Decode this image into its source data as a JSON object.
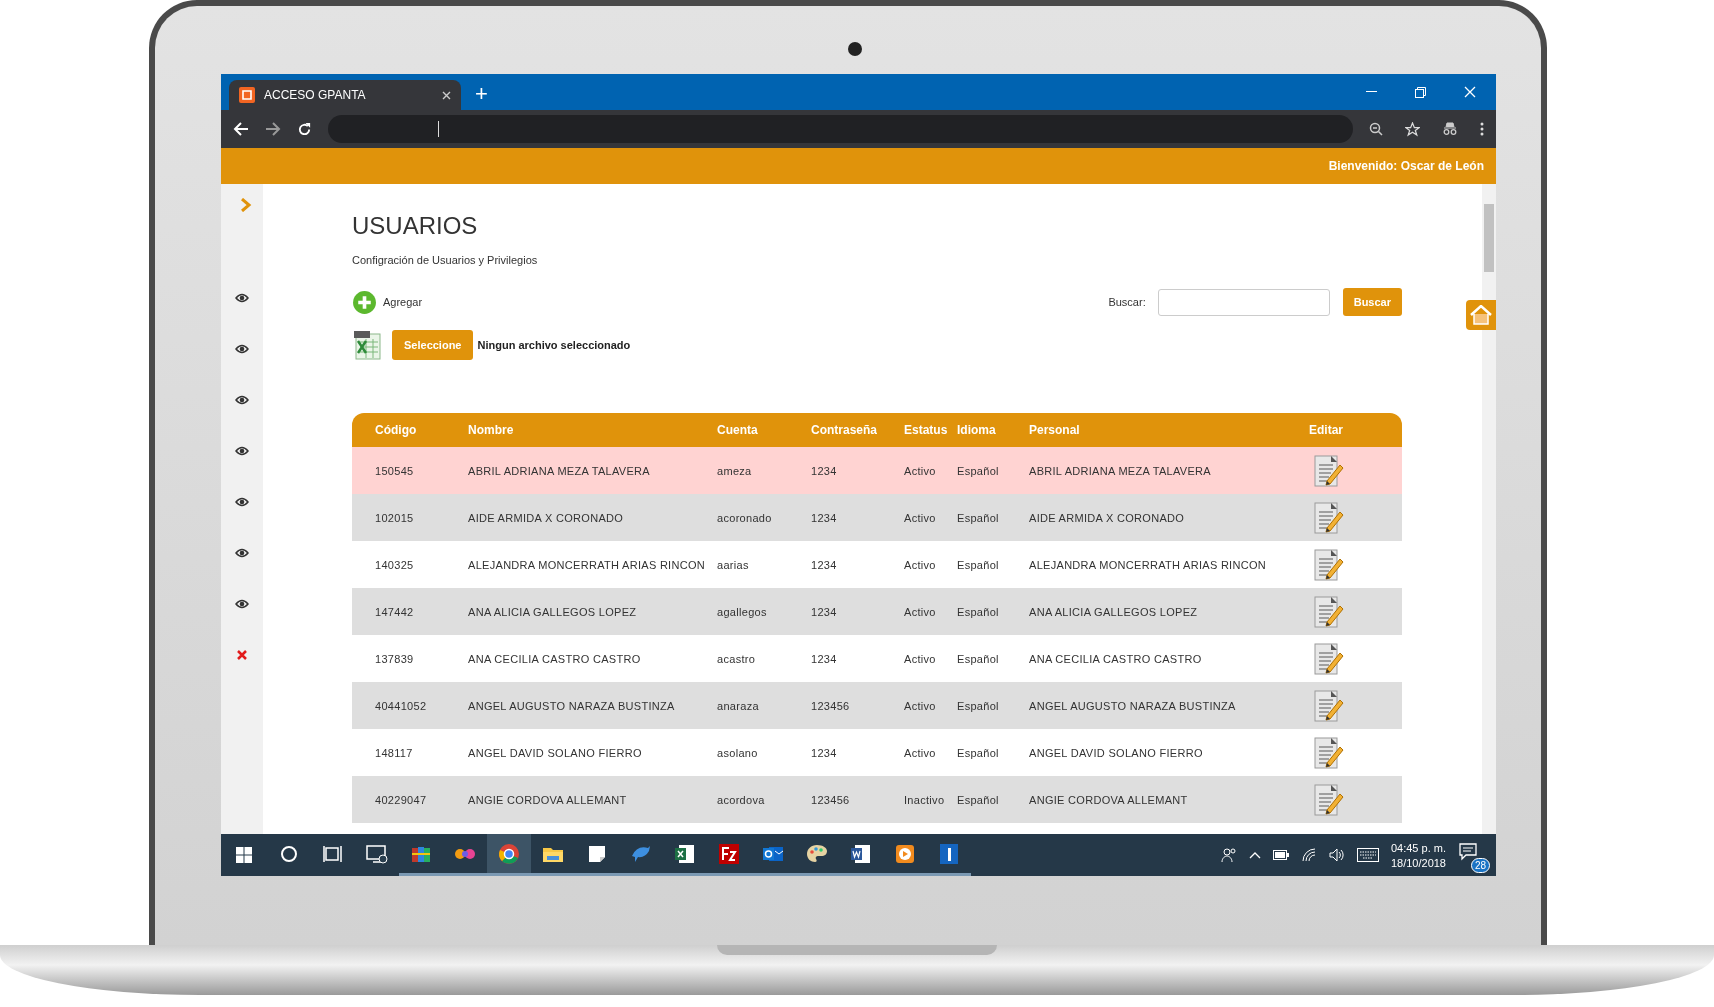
{
  "browser": {
    "tab": {
      "title": "ACCESO GPANTA",
      "selected": true
    },
    "new_tab": "+"
  },
  "header": {
    "welcome": "Bienvenido: Oscar de León"
  },
  "sidebar": {
    "items": [
      {
        "kind": "expand"
      },
      {
        "kind": "view"
      },
      {
        "kind": "view"
      },
      {
        "kind": "view"
      },
      {
        "kind": "view"
      },
      {
        "kind": "view"
      },
      {
        "kind": "view"
      },
      {
        "kind": "view"
      },
      {
        "kind": "close"
      }
    ]
  },
  "page": {
    "title": "USUARIOS",
    "subtitle": "Configración de Usuarios y Privilegios",
    "add": "Agregar",
    "search_label": "Buscar:",
    "search_button": "Buscar",
    "file_button": "Seleccione",
    "file_status": "Ningun archivo seleccionado"
  },
  "table": {
    "columns": [
      "Código",
      "Nombre",
      "Cuenta",
      "Contraseña",
      "Estatus",
      "Idioma",
      "Personal",
      "Editar"
    ],
    "rows": [
      {
        "cells": [
          "150545",
          "ABRIL ADRIANA MEZA TALAVERA",
          "ameza",
          "1234",
          "Activo",
          "Español",
          "ABRIL ADRIANA MEZA TALAVERA"
        ],
        "selected": true
      },
      {
        "cells": [
          "102015",
          "AIDE ARMIDA X CORONADO",
          "acoronado",
          "1234",
          "Activo",
          "Español",
          "AIDE ARMIDA X CORONADO"
        ],
        "selected": false
      },
      {
        "cells": [
          "140325",
          "ALEJANDRA MONCERRATH ARIAS RINCON",
          "aarias",
          "1234",
          "Activo",
          "Español",
          "ALEJANDRA MONCERRATH ARIAS RINCON"
        ],
        "selected": false
      },
      {
        "cells": [
          "147442",
          "ANA ALICIA GALLEGOS LOPEZ",
          "agallegos",
          "1234",
          "Activo",
          "Español",
          "ANA ALICIA GALLEGOS LOPEZ"
        ],
        "selected": false
      },
      {
        "cells": [
          "137839",
          "ANA CECILIA CASTRO CASTRO",
          "acastro",
          "1234",
          "Activo",
          "Español",
          "ANA CECILIA CASTRO CASTRO"
        ],
        "selected": false
      },
      {
        "cells": [
          "40441052",
          "ANGEL AUGUSTO NARAZA BUSTINZA",
          "anaraza",
          "123456",
          "Activo",
          "Español",
          "ANGEL AUGUSTO NARAZA BUSTINZA"
        ],
        "selected": false
      },
      {
        "cells": [
          "148117",
          "ANGEL DAVID SOLANO FIERRO",
          "asolano",
          "1234",
          "Activo",
          "Español",
          "ANGEL DAVID SOLANO FIERRO"
        ],
        "selected": false
      },
      {
        "cells": [
          "40229047",
          "ANGIE CORDOVA ALLEMANT",
          "acordova",
          "123456",
          "Inactivo",
          "Español",
          "ANGIE CORDOVA ALLEMANT"
        ],
        "selected": false
      }
    ]
  },
  "taskbar": {
    "apps": [
      {
        "kind": "search",
        "running": false,
        "selected": false
      },
      {
        "kind": "taskview",
        "running": false,
        "selected": false
      },
      {
        "kind": "remote",
        "running": false,
        "selected": false
      },
      {
        "kind": "archive",
        "running": true,
        "selected": false
      },
      {
        "kind": "butterfly",
        "running": true,
        "selected": false
      },
      {
        "kind": "browser",
        "running": true,
        "selected": true
      },
      {
        "kind": "folder",
        "running": true,
        "selected": false
      },
      {
        "kind": "note",
        "running": true,
        "selected": false
      },
      {
        "kind": "dolphin",
        "running": true,
        "selected": false
      },
      {
        "kind": "sheet",
        "running": true,
        "selected": false
      },
      {
        "kind": "ftp",
        "running": true,
        "selected": false
      },
      {
        "kind": "mail",
        "running": true,
        "selected": false
      },
      {
        "kind": "paint",
        "running": true,
        "selected": false
      },
      {
        "kind": "doc",
        "running": true,
        "selected": false
      },
      {
        "kind": "player",
        "running": true,
        "selected": false
      },
      {
        "kind": "bluebar",
        "running": true,
        "selected": false
      }
    ],
    "time": "04:45 p. m.",
    "date": "18/10/2018",
    "notifications": "28"
  }
}
